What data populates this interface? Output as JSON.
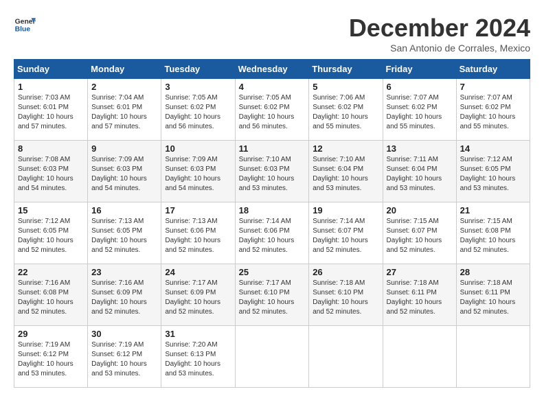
{
  "logo": {
    "line1": "General",
    "line2": "Blue"
  },
  "title": "December 2024",
  "subtitle": "San Antonio de Corrales, Mexico",
  "days_of_week": [
    "Sunday",
    "Monday",
    "Tuesday",
    "Wednesday",
    "Thursday",
    "Friday",
    "Saturday"
  ],
  "weeks": [
    [
      {
        "day": "1",
        "info": "Sunrise: 7:03 AM\nSunset: 6:01 PM\nDaylight: 10 hours\nand 57 minutes."
      },
      {
        "day": "2",
        "info": "Sunrise: 7:04 AM\nSunset: 6:01 PM\nDaylight: 10 hours\nand 57 minutes."
      },
      {
        "day": "3",
        "info": "Sunrise: 7:05 AM\nSunset: 6:02 PM\nDaylight: 10 hours\nand 56 minutes."
      },
      {
        "day": "4",
        "info": "Sunrise: 7:05 AM\nSunset: 6:02 PM\nDaylight: 10 hours\nand 56 minutes."
      },
      {
        "day": "5",
        "info": "Sunrise: 7:06 AM\nSunset: 6:02 PM\nDaylight: 10 hours\nand 55 minutes."
      },
      {
        "day": "6",
        "info": "Sunrise: 7:07 AM\nSunset: 6:02 PM\nDaylight: 10 hours\nand 55 minutes."
      },
      {
        "day": "7",
        "info": "Sunrise: 7:07 AM\nSunset: 6:02 PM\nDaylight: 10 hours\nand 55 minutes."
      }
    ],
    [
      {
        "day": "8",
        "info": "Sunrise: 7:08 AM\nSunset: 6:03 PM\nDaylight: 10 hours\nand 54 minutes."
      },
      {
        "day": "9",
        "info": "Sunrise: 7:09 AM\nSunset: 6:03 PM\nDaylight: 10 hours\nand 54 minutes."
      },
      {
        "day": "10",
        "info": "Sunrise: 7:09 AM\nSunset: 6:03 PM\nDaylight: 10 hours\nand 54 minutes."
      },
      {
        "day": "11",
        "info": "Sunrise: 7:10 AM\nSunset: 6:03 PM\nDaylight: 10 hours\nand 53 minutes."
      },
      {
        "day": "12",
        "info": "Sunrise: 7:10 AM\nSunset: 6:04 PM\nDaylight: 10 hours\nand 53 minutes."
      },
      {
        "day": "13",
        "info": "Sunrise: 7:11 AM\nSunset: 6:04 PM\nDaylight: 10 hours\nand 53 minutes."
      },
      {
        "day": "14",
        "info": "Sunrise: 7:12 AM\nSunset: 6:05 PM\nDaylight: 10 hours\nand 53 minutes."
      }
    ],
    [
      {
        "day": "15",
        "info": "Sunrise: 7:12 AM\nSunset: 6:05 PM\nDaylight: 10 hours\nand 52 minutes."
      },
      {
        "day": "16",
        "info": "Sunrise: 7:13 AM\nSunset: 6:05 PM\nDaylight: 10 hours\nand 52 minutes."
      },
      {
        "day": "17",
        "info": "Sunrise: 7:13 AM\nSunset: 6:06 PM\nDaylight: 10 hours\nand 52 minutes."
      },
      {
        "day": "18",
        "info": "Sunrise: 7:14 AM\nSunset: 6:06 PM\nDaylight: 10 hours\nand 52 minutes."
      },
      {
        "day": "19",
        "info": "Sunrise: 7:14 AM\nSunset: 6:07 PM\nDaylight: 10 hours\nand 52 minutes."
      },
      {
        "day": "20",
        "info": "Sunrise: 7:15 AM\nSunset: 6:07 PM\nDaylight: 10 hours\nand 52 minutes."
      },
      {
        "day": "21",
        "info": "Sunrise: 7:15 AM\nSunset: 6:08 PM\nDaylight: 10 hours\nand 52 minutes."
      }
    ],
    [
      {
        "day": "22",
        "info": "Sunrise: 7:16 AM\nSunset: 6:08 PM\nDaylight: 10 hours\nand 52 minutes."
      },
      {
        "day": "23",
        "info": "Sunrise: 7:16 AM\nSunset: 6:09 PM\nDaylight: 10 hours\nand 52 minutes."
      },
      {
        "day": "24",
        "info": "Sunrise: 7:17 AM\nSunset: 6:09 PM\nDaylight: 10 hours\nand 52 minutes."
      },
      {
        "day": "25",
        "info": "Sunrise: 7:17 AM\nSunset: 6:10 PM\nDaylight: 10 hours\nand 52 minutes."
      },
      {
        "day": "26",
        "info": "Sunrise: 7:18 AM\nSunset: 6:10 PM\nDaylight: 10 hours\nand 52 minutes."
      },
      {
        "day": "27",
        "info": "Sunrise: 7:18 AM\nSunset: 6:11 PM\nDaylight: 10 hours\nand 52 minutes."
      },
      {
        "day": "28",
        "info": "Sunrise: 7:18 AM\nSunset: 6:11 PM\nDaylight: 10 hours\nand 52 minutes."
      }
    ],
    [
      {
        "day": "29",
        "info": "Sunrise: 7:19 AM\nSunset: 6:12 PM\nDaylight: 10 hours\nand 53 minutes."
      },
      {
        "day": "30",
        "info": "Sunrise: 7:19 AM\nSunset: 6:12 PM\nDaylight: 10 hours\nand 53 minutes."
      },
      {
        "day": "31",
        "info": "Sunrise: 7:20 AM\nSunset: 6:13 PM\nDaylight: 10 hours\nand 53 minutes."
      },
      {
        "day": "",
        "info": ""
      },
      {
        "day": "",
        "info": ""
      },
      {
        "day": "",
        "info": ""
      },
      {
        "day": "",
        "info": ""
      }
    ]
  ]
}
